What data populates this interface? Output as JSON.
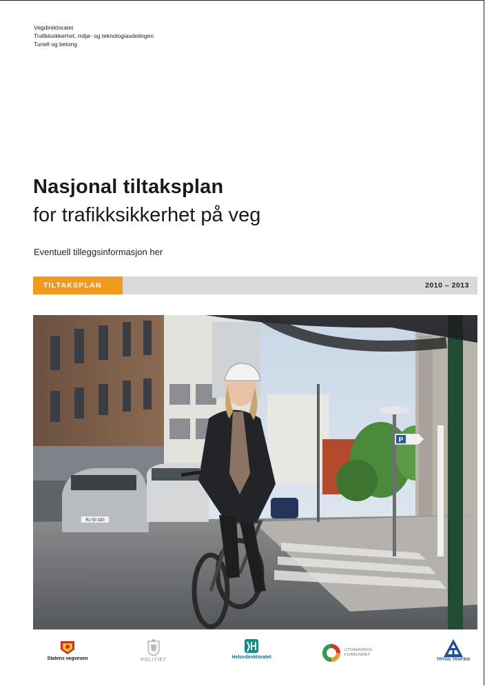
{
  "header": {
    "line1": "Vegdirektoratet",
    "line2": "Trafikksikkerhet, miljø- og teknologiavdelingen",
    "line3": "Tunell og betong"
  },
  "title": {
    "bold": "Nasjonal tiltaksplan",
    "light": "for trafikksikkerhet på veg"
  },
  "subtitle": "Eventuell tilleggsinformasjon her",
  "band": {
    "tag": "TILTAKSPLAN",
    "years": "2010 – 2013"
  },
  "photo": {
    "parking_sign": "P",
    "plate": "RJ 50 320"
  },
  "logos": [
    {
      "name": "Statens vegvesen",
      "icon": "statens-vegvesen-logo"
    },
    {
      "name": "POLITIET",
      "icon": "politiet-logo"
    },
    {
      "name": "Helsedirektoratet",
      "icon": "helsedirektoratet-logo"
    },
    {
      "name": "UTDANNINGS FORBUNDET",
      "line1": "UTDANNINGS",
      "line2": "FORBUNDET",
      "icon": "utdanningsforbundet-logo"
    },
    {
      "name": "TRYGG TRAFIKK",
      "icon": "trygg-trafikk-logo"
    }
  ],
  "colors": {
    "accent_orange": "#f39a1e",
    "band_gray": "#d9d9d9"
  }
}
